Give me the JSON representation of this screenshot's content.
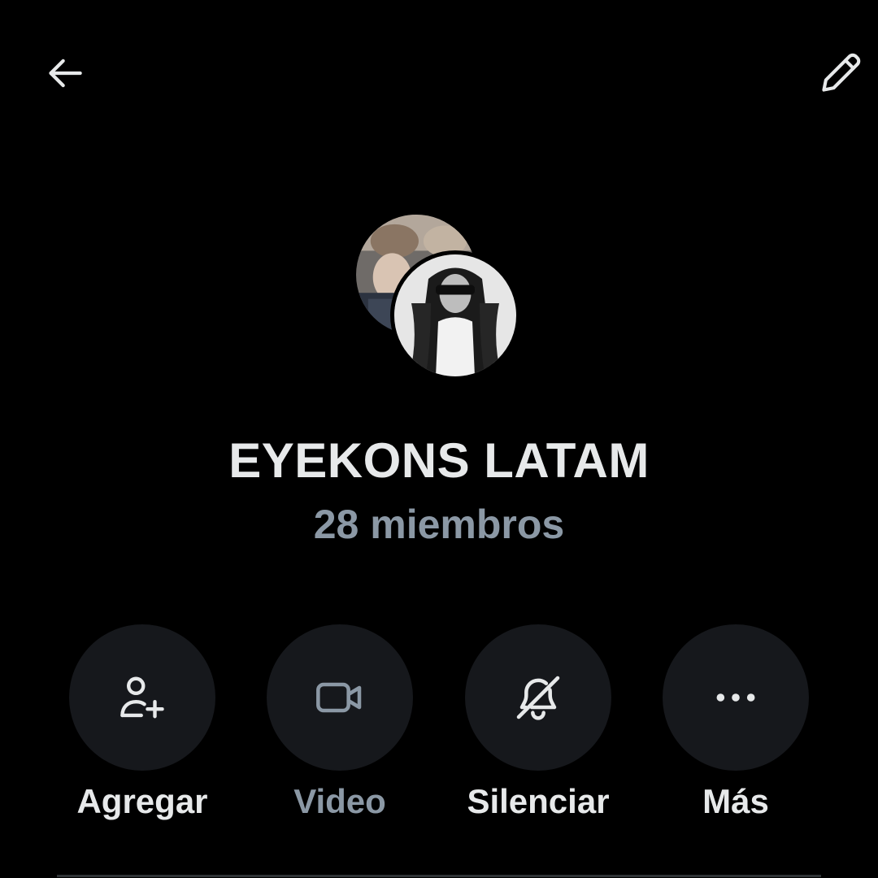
{
  "header": {
    "back_icon": "arrow-left-icon",
    "edit_icon": "pencil-icon"
  },
  "group": {
    "name": "EYEKONS LATAM",
    "members": "28 miembros"
  },
  "actions": [
    {
      "label": "Agregar",
      "icon": "add-user-icon",
      "enabled": true
    },
    {
      "label": "Video",
      "icon": "video-camera-icon",
      "enabled": false
    },
    {
      "label": "Silenciar",
      "icon": "bell-off-icon",
      "enabled": true
    },
    {
      "label": "Más",
      "icon": "more-dots-icon",
      "enabled": true
    }
  ],
  "colors": {
    "background": "#000000",
    "text_primary": "#e7e9ea",
    "text_secondary": "#8b98a5",
    "action_circle": "#16181c"
  }
}
